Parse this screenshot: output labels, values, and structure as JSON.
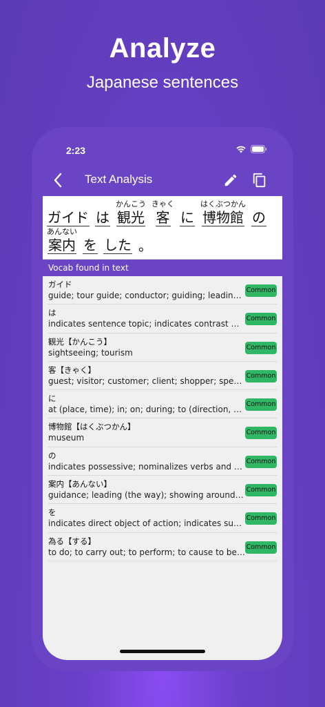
{
  "promo": {
    "headline": "Analyze",
    "subline": "Japanese sentences"
  },
  "status_bar": {
    "time": "2:23"
  },
  "nav": {
    "title": "Text Analysis"
  },
  "sentence": {
    "line1": [
      {
        "furigana": "",
        "text": "ガイド",
        "underline": true
      },
      {
        "furigana": "",
        "text": "は",
        "underline": true
      },
      {
        "furigana": "かんこう",
        "text": "観光",
        "underline": true
      },
      {
        "furigana": "きゃく",
        "text": "客",
        "underline": true
      },
      {
        "furigana": "",
        "text": "に",
        "underline": true
      },
      {
        "furigana": "はくぶつかん",
        "text": "博物館",
        "underline": true
      },
      {
        "furigana": "",
        "text": "の",
        "underline": true
      }
    ],
    "line2": [
      {
        "furigana": "あんない",
        "text": "案内",
        "underline": true
      },
      {
        "furigana": "",
        "text": "を",
        "underline": true
      },
      {
        "furigana": "",
        "text": "した",
        "underline": true
      },
      {
        "furigana": "",
        "text": "。",
        "underline": false
      }
    ]
  },
  "vocab_section_label": "Vocab found in text",
  "vocab": [
    {
      "word": "ガイド",
      "gloss": "guide; tour guide; conductor; guiding; leading; guidance",
      "badge": "Common"
    },
    {
      "word": "は",
      "gloss": "indicates sentence topic; indicates contrast with another option",
      "badge": "Common"
    },
    {
      "word": "観光【かんこう】",
      "gloss": "sightseeing; tourism",
      "badge": "Common"
    },
    {
      "word": "客【きゃく】",
      "gloss": "guest; visitor; customer; client; shopper; spectator; audience",
      "badge": "Common"
    },
    {
      "word": "に",
      "gloss": "at (place, time); in; on; during; to (direction, state); toward",
      "badge": "Common"
    },
    {
      "word": "博物館【はくぶつかん】",
      "gloss": "museum",
      "badge": "Common"
    },
    {
      "word": "の",
      "gloss": "indicates possessive; nominalizes verbs and adjectives",
      "badge": "Common"
    },
    {
      "word": "案内【あんない】",
      "gloss": "guidance; leading (the way); showing around; information",
      "badge": "Common"
    },
    {
      "word": "を",
      "gloss": "indicates direct object of action; indicates subject of causative",
      "badge": "Common"
    },
    {
      "word": "為る【する】",
      "gloss": "to do; to carry out; to perform; to cause to become; to make",
      "badge": "Common"
    }
  ]
}
